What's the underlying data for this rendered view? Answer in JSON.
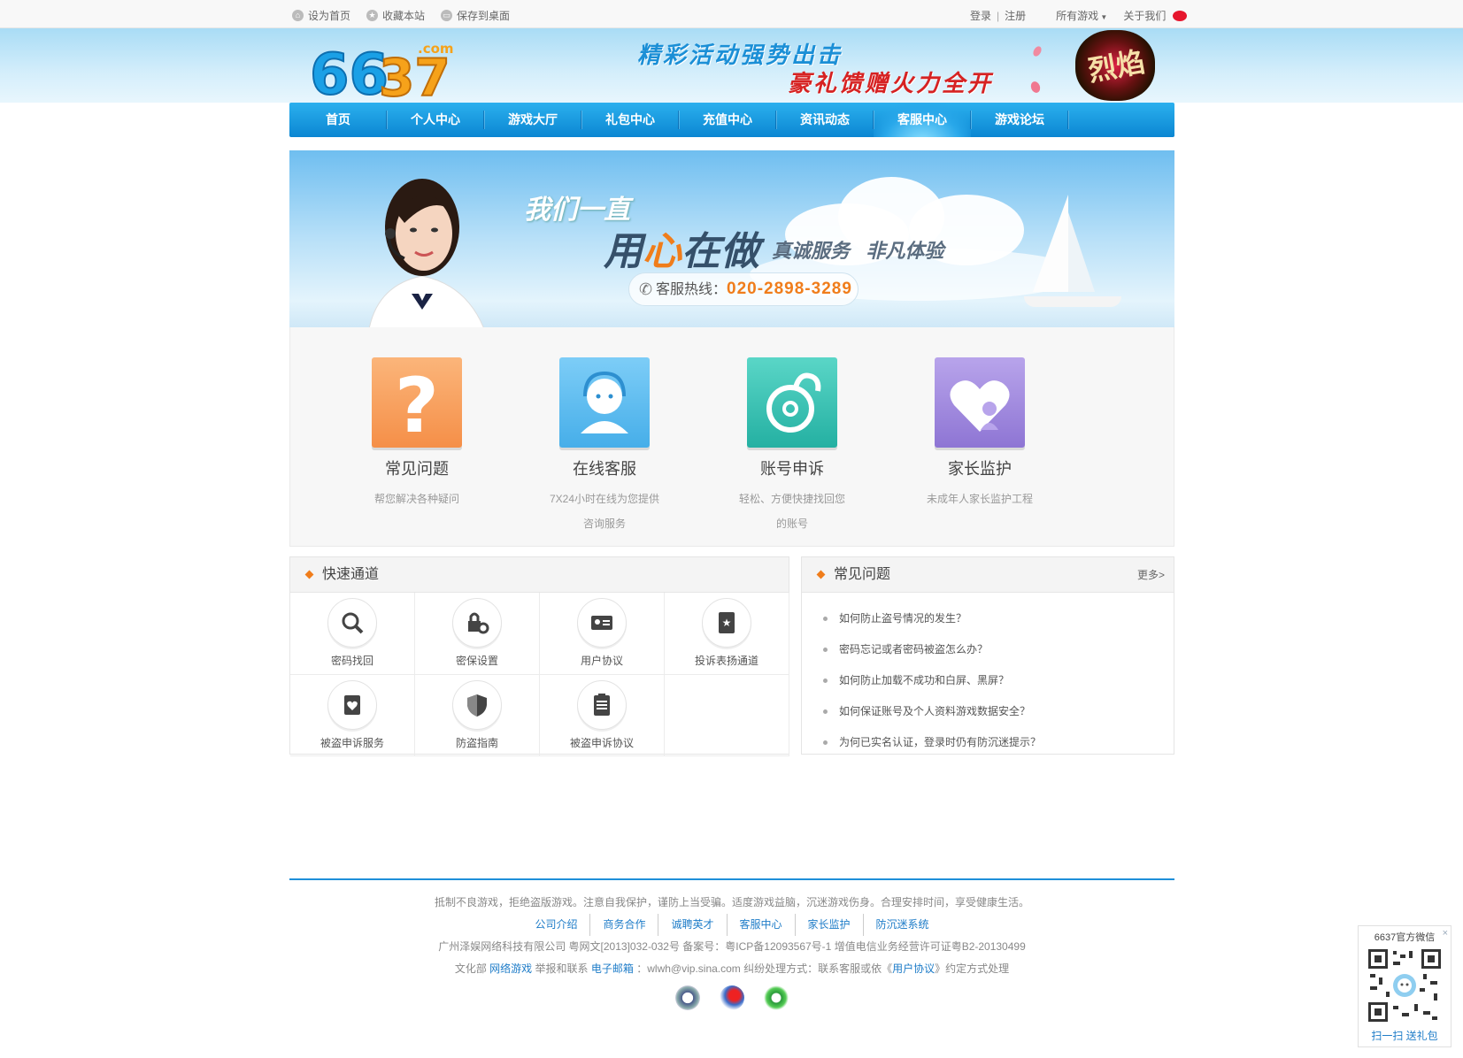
{
  "topbar": {
    "set_home": "设为首页",
    "bookmark": "收藏本站",
    "save_desktop": "保存到桌面",
    "login": "登录",
    "register": "注册",
    "all_games": "所有游戏",
    "about": "关于我们"
  },
  "header": {
    "logo_text": "6637",
    "logo_suffix": ".com",
    "slogan_line1": "精彩活动强势出击",
    "slogan_line2": "豪礼馈赠火力全开",
    "game_badge": "烈焰"
  },
  "nav": {
    "items": [
      "首页",
      "个人中心",
      "游戏大厅",
      "礼包中心",
      "充值中心",
      "资讯动态",
      "客服中心",
      "游戏论坛"
    ],
    "active": "客服中心"
  },
  "banner": {
    "line1": "我们一直",
    "line2_a": "用",
    "line2_b": "心",
    "line2_c": "在做",
    "line3": "真诚服务   非凡体验",
    "hotline_label": "客服热线：",
    "hotline_number": "020-2898-3289"
  },
  "services": [
    {
      "title": "常见问题",
      "desc": "帮您解决各种疑问",
      "color": "#f7a25a"
    },
    {
      "title": "在线客服",
      "desc": "7X24小时在线为您提供咨询服务",
      "color": "#5ab8ee"
    },
    {
      "title": "账号申诉",
      "desc": "轻松、方便快捷找回您的账号",
      "color": "#36c1b4"
    },
    {
      "title": "家长监护",
      "desc": "未成年人家长监护工程",
      "color": "#a48fdb"
    }
  ],
  "quick": {
    "title": "快速通道",
    "items": [
      "密码找回",
      "密保设置",
      "用户协议",
      "投诉表扬通道",
      "被盗申诉服务",
      "防盗指南",
      "被盗申诉协议"
    ]
  },
  "faq": {
    "title": "常见问题",
    "more": "更多>",
    "items": [
      "如何防止盗号情况的发生？",
      "密码忘记或者密码被盗怎么办？",
      "如何防止加载不成功和白屏、黑屏？",
      "如何保证账号及个人资料游戏数据安全？",
      "为何已实名认证，登录时仍有防沉迷提示？"
    ]
  },
  "footer": {
    "line1": "抵制不良游戏，拒绝盗版游戏。注意自我保护，谨防上当受骗。适度游戏益脑，沉迷游戏伤身。合理安排时间，享受健康生活。",
    "links": [
      "公司介绍",
      "商务合作",
      "诚聘英才",
      "客服中心",
      "家长监护",
      "防沉迷系统"
    ],
    "line3": "广州泽娱网络科技有限公司 粤网文[2013]032-032号 备案号：粤ICP备12093567号-1 增值电信业务经营许可证粤B2-20130499",
    "line4_a": "文化部",
    "line4_link1": "网络游戏",
    "line4_b": "举报和联系",
    "line4_link2": "电子邮箱",
    "line4_c": "：wlwh@vip.sina.com 纠纷处理方式：联系客服或依《",
    "line4_link3": "用户协议",
    "line4_d": "》约定方式处理"
  },
  "qr": {
    "title": "6637官方微信",
    "close": "×",
    "bottom": "扫一扫 送礼包"
  }
}
